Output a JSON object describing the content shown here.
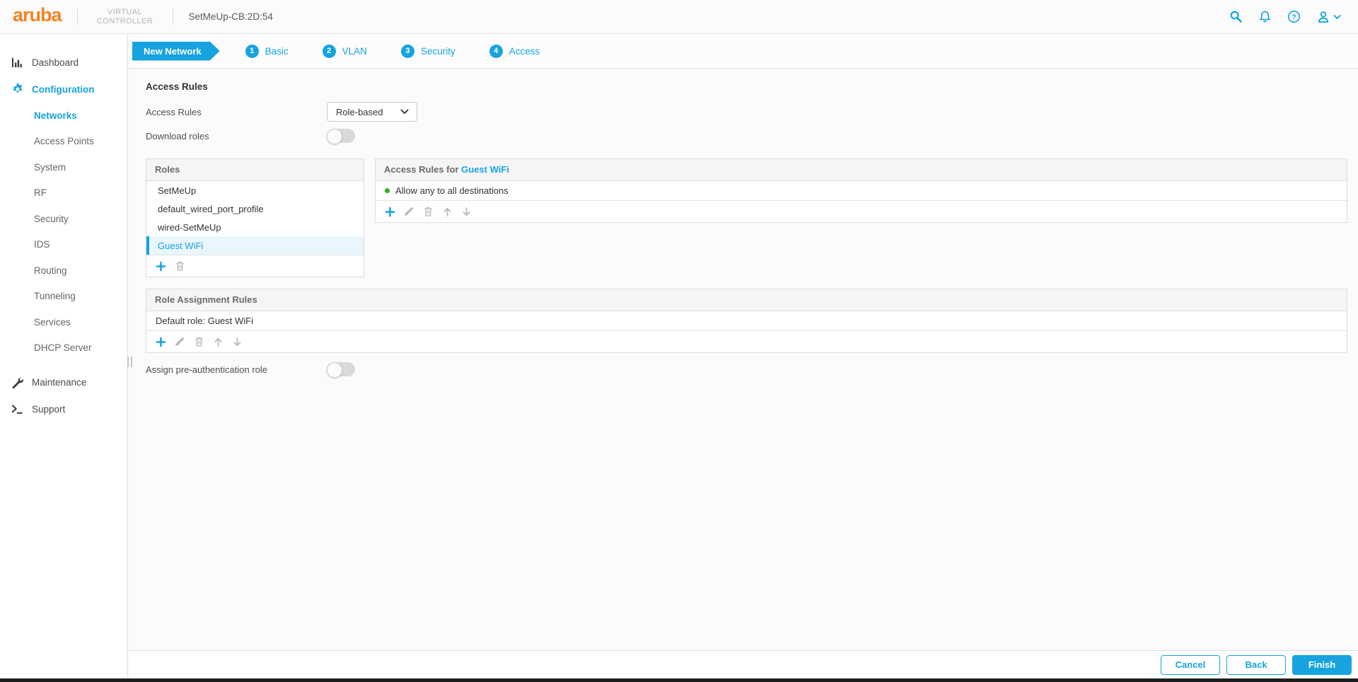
{
  "colors": {
    "accent": "#17A3E0",
    "logo_orange": "#F5831F",
    "selected_row_bg": "#E9F6FD",
    "allow_green": "#2DB216"
  },
  "header": {
    "logo_text": "aruba",
    "product_name": "VIRTUAL CONTROLLER",
    "controller_name": "SetMeUp-CB:2D:54",
    "icons": [
      "search-icon",
      "notifications-icon",
      "help-icon",
      "account-icon",
      "chevron-down-icon"
    ]
  },
  "sidebar": {
    "dashboard_label": "Dashboard",
    "configuration_label": "Configuration",
    "config_items": [
      {
        "label": "Networks",
        "active": true
      },
      {
        "label": "Access Points"
      },
      {
        "label": "System"
      },
      {
        "label": "RF"
      },
      {
        "label": "Security"
      },
      {
        "label": "IDS"
      },
      {
        "label": "Routing"
      },
      {
        "label": "Tunneling"
      },
      {
        "label": "Services"
      },
      {
        "label": "DHCP Server"
      }
    ],
    "maintenance_label": "Maintenance",
    "support_label": "Support"
  },
  "wizard": {
    "banner": "New Network",
    "steps": [
      {
        "num": "1",
        "label": "Basic"
      },
      {
        "num": "2",
        "label": "VLAN"
      },
      {
        "num": "3",
        "label": "Security"
      },
      {
        "num": "4",
        "label": "Access"
      }
    ]
  },
  "access_rules": {
    "section_title": "Access Rules",
    "mode_label": "Access Rules",
    "mode_value": "Role-based",
    "download_roles_label": "Download roles",
    "download_roles_state": "off"
  },
  "roles_panel": {
    "header": "Roles",
    "roles": [
      {
        "label": "SetMeUp"
      },
      {
        "label": "default_wired_port_profile"
      },
      {
        "label": "wired-SetMeUp"
      },
      {
        "label": "Guest WiFi",
        "selected": true
      }
    ],
    "toolbar": [
      "add-icon",
      "delete-icon"
    ]
  },
  "rules_panel": {
    "header_prefix": "Access Rules for",
    "selected_role": "Guest WiFi",
    "rules": [
      {
        "label": "Allow any to all destinations",
        "status": "allow"
      }
    ],
    "toolbar": [
      "add-icon",
      "edit-icon",
      "delete-icon",
      "move-up-icon",
      "move-down-icon"
    ]
  },
  "role_assignment": {
    "header": "Role Assignment Rules",
    "rows": [
      {
        "label": "Default role: Guest WiFi"
      }
    ],
    "toolbar": [
      "add-icon",
      "edit-icon",
      "delete-icon",
      "move-up-icon",
      "move-down-icon"
    ]
  },
  "pre_auth": {
    "label": "Assign pre-authentication role",
    "state": "off"
  },
  "footer": {
    "cancel_label": "Cancel",
    "back_label": "Back",
    "finish_label": "Finish"
  }
}
